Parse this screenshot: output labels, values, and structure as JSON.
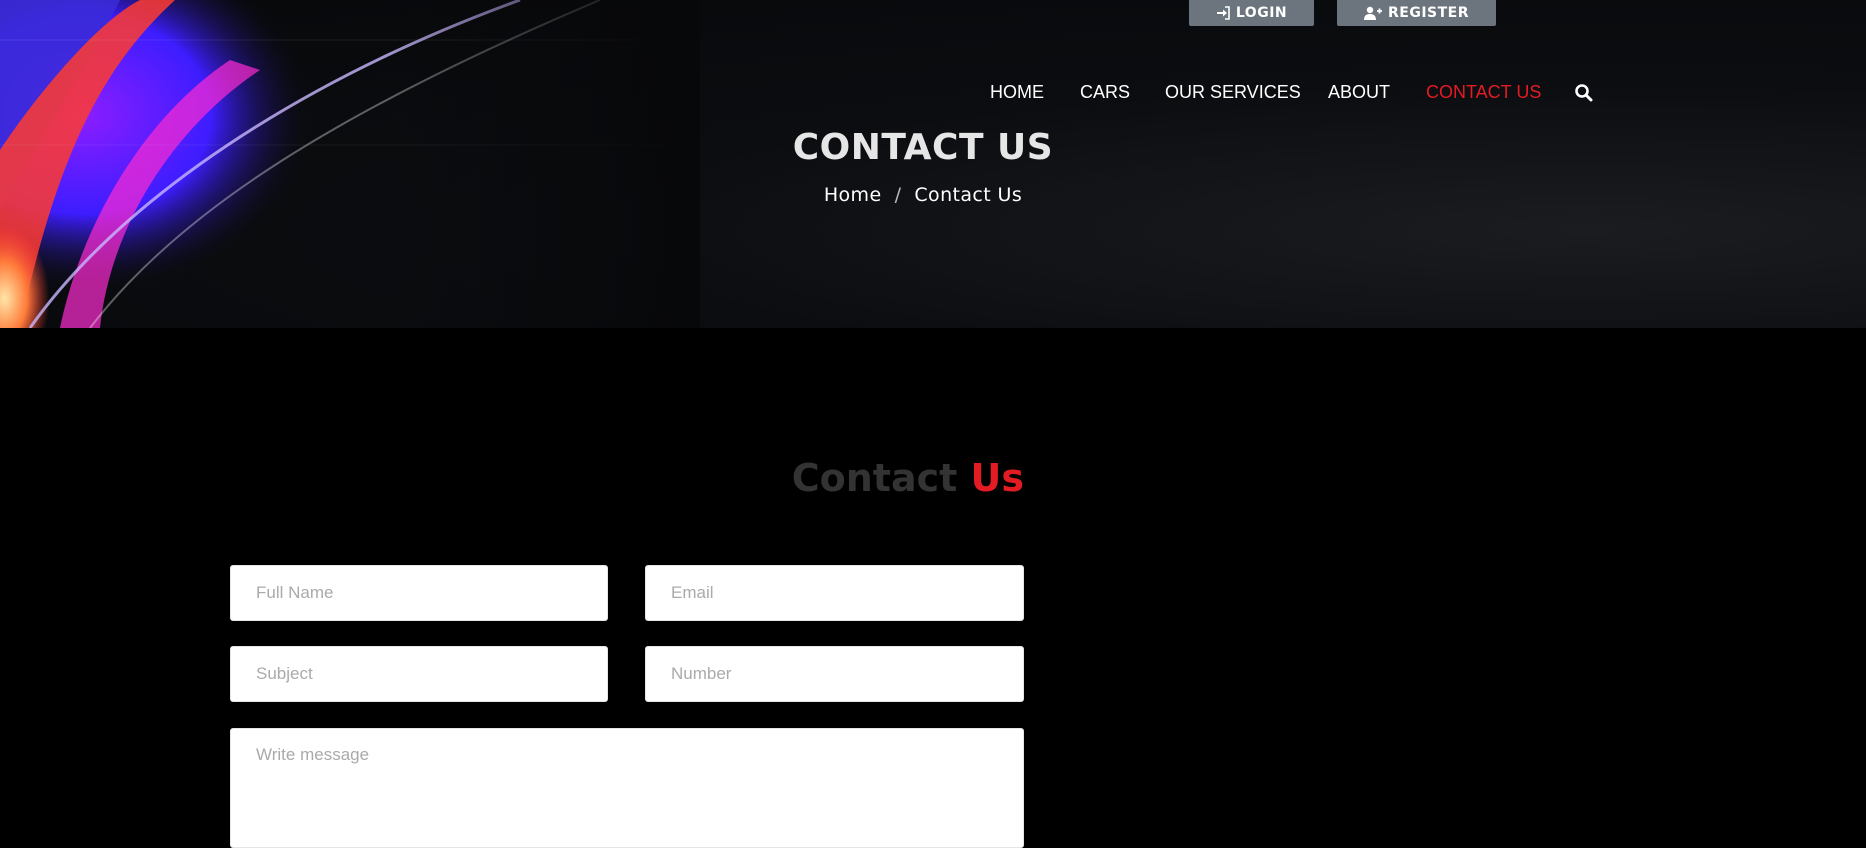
{
  "header": {
    "login_label": "LOGIN",
    "register_label": "REGISTER",
    "login_icon": "sign-in-icon",
    "register_icon": "user-plus-icon"
  },
  "nav": {
    "items": [
      {
        "label": "HOME",
        "active": false
      },
      {
        "label": "CARS",
        "active": false
      },
      {
        "label": "OUR SERVICES",
        "active": false
      },
      {
        "label": "ABOUT",
        "active": false
      },
      {
        "label": "CONTACT US",
        "active": true
      }
    ],
    "search_icon": "search-icon"
  },
  "banner": {
    "title": "CONTACT US",
    "breadcrumb": {
      "home": "Home",
      "separator": "/",
      "current": "Contact Us"
    }
  },
  "contact_section": {
    "heading_part1": "Contact",
    "heading_part2": "Us"
  },
  "form": {
    "full_name_placeholder": "Full Name",
    "email_placeholder": "Email",
    "subject_placeholder": "Subject",
    "number_placeholder": "Number",
    "message_placeholder": "Write message"
  },
  "colors": {
    "accent": "#e31b23",
    "button_gray": "#6c757d",
    "background": "#000000"
  }
}
